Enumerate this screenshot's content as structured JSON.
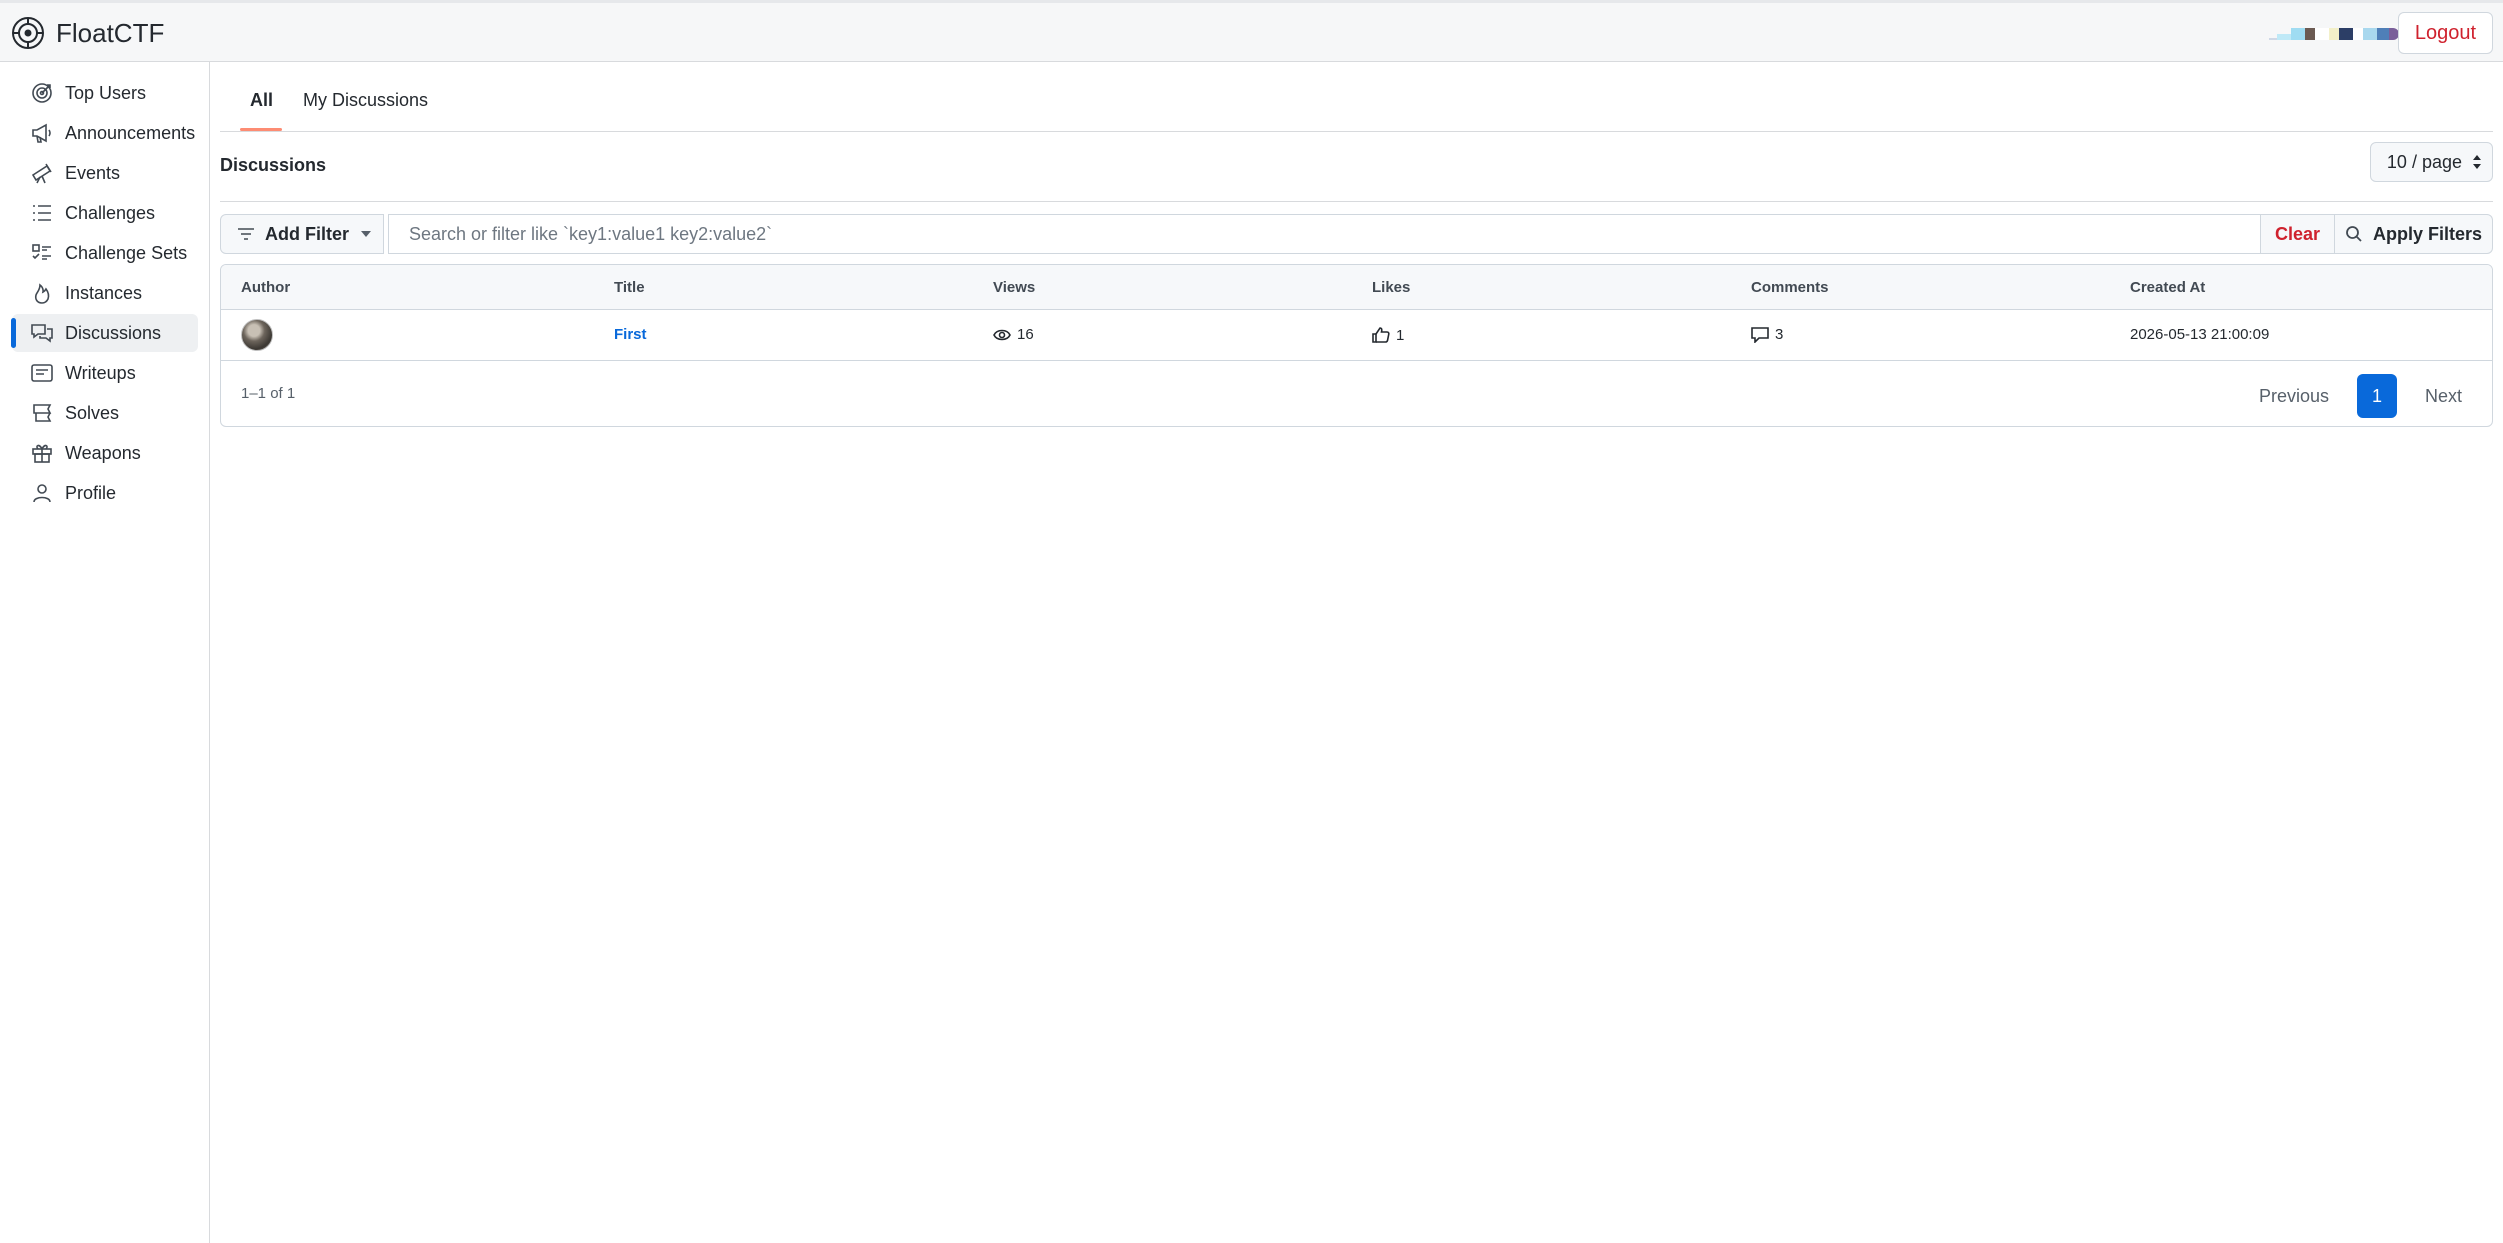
{
  "app": {
    "brand_name": "FloatCTF",
    "logout_label": "Logout",
    "user_swatch_colors": [
      "#cfd8e6",
      "#bfe9f7",
      "#9fdcf2",
      "#6b5a52",
      "#f3f0c9",
      "#2c3e66",
      "#a9d8ee",
      "#4f7fb8",
      "#7a5f9a"
    ]
  },
  "sidebar": {
    "items": [
      {
        "label": "Top Users",
        "icon": "target-icon"
      },
      {
        "label": "Announcements",
        "icon": "megaphone-icon"
      },
      {
        "label": "Events",
        "icon": "telescope-icon"
      },
      {
        "label": "Challenges",
        "icon": "list-icon"
      },
      {
        "label": "Challenge Sets",
        "icon": "tasklist-icon"
      },
      {
        "label": "Instances",
        "icon": "flame-icon"
      },
      {
        "label": "Discussions",
        "icon": "comment-discussion-icon",
        "active": true
      },
      {
        "label": "Writeups",
        "icon": "note-icon"
      },
      {
        "label": "Solves",
        "icon": "stack-icon"
      },
      {
        "label": "Weapons",
        "icon": "gift-icon"
      },
      {
        "label": "Profile",
        "icon": "person-icon"
      }
    ]
  },
  "tabs": [
    {
      "label": "All",
      "active": true
    },
    {
      "label": "My Discussions",
      "active": false
    }
  ],
  "section": {
    "title": "Discussions",
    "per_page": "10 / page"
  },
  "filters": {
    "add_filter_label": "Add Filter",
    "search_placeholder": "Search or filter like `key1:value1 key2:value2`",
    "clear_label": "Clear",
    "apply_label": "Apply Filters"
  },
  "table": {
    "columns": [
      "Author",
      "Title",
      "Views",
      "Likes",
      "Comments",
      "Created At"
    ],
    "rows": [
      {
        "title": "First",
        "views": "16",
        "likes": "1",
        "comments": "3",
        "created_at": "2026-05-13 21:00:09"
      }
    ],
    "count_text": "1–1 of 1"
  },
  "pagination": {
    "previous_label": "Previous",
    "current_page": "1",
    "next_label": "Next"
  }
}
